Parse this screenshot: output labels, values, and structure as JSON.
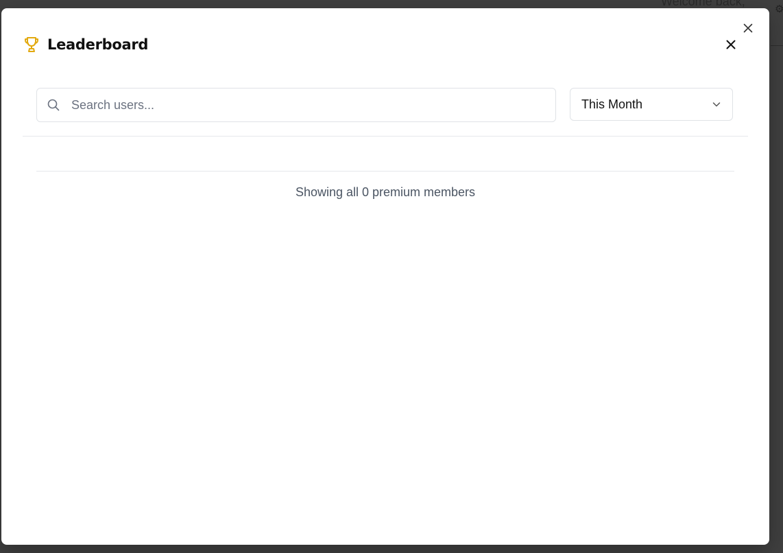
{
  "background": {
    "welcome_text": "Welcome back,"
  },
  "modal": {
    "title": "Leaderboard",
    "title_icon": "trophy-icon",
    "accent_color": "#e2a90f",
    "close_icons": [
      "close-icon",
      "close-icon"
    ]
  },
  "search": {
    "placeholder": "Search users...",
    "value": "",
    "icon": "search-icon"
  },
  "period_filter": {
    "selected": "This Month",
    "icon": "chevron-down-icon"
  },
  "summary": {
    "text": "Showing all 0 premium members"
  }
}
